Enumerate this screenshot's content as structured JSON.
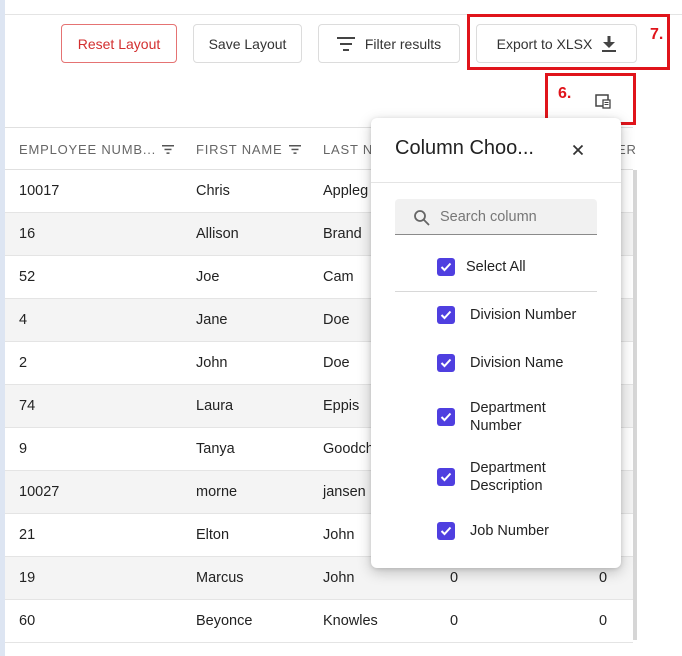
{
  "toolbar": {
    "reset_label": "Reset Layout",
    "save_label": "Save Layout",
    "filter_label": "Filter results",
    "export_label": "Export to XLSX"
  },
  "annotations": {
    "label_6": "6.",
    "label_7": "7.",
    "color": "#e0141b"
  },
  "grid": {
    "headers": [
      "EMPLOYEE NUMB...",
      "FIRST NAME",
      "LAST N",
      "",
      "ER"
    ],
    "rows": [
      [
        "10017",
        "Chris",
        "Appleg",
        "",
        ""
      ],
      [
        "16",
        "Allison",
        "Brand",
        "",
        ""
      ],
      [
        "52",
        "Joe",
        "Cam",
        "",
        ""
      ],
      [
        "4",
        "Jane",
        "Doe",
        "",
        ""
      ],
      [
        "2",
        "John",
        "Doe",
        "",
        ""
      ],
      [
        "74",
        "Laura",
        "Eppis",
        "",
        ""
      ],
      [
        "9",
        "Tanya",
        "Goodch",
        "",
        ""
      ],
      [
        "10027",
        "morne",
        "jansen",
        "",
        ""
      ],
      [
        "21",
        "Elton",
        "John",
        "",
        ""
      ],
      [
        "19",
        "Marcus",
        "John",
        "0",
        "0"
      ],
      [
        "60",
        "Beyonce",
        "Knowles",
        "0",
        "0"
      ]
    ]
  },
  "column_chooser": {
    "title": "Column Choo...",
    "search_placeholder": "Search column",
    "select_all_label": "Select All",
    "options": [
      "Division Number",
      "Division Name",
      "Department Number",
      "Department Description",
      "Job Number"
    ],
    "accent_color": "#4f3fe0"
  }
}
